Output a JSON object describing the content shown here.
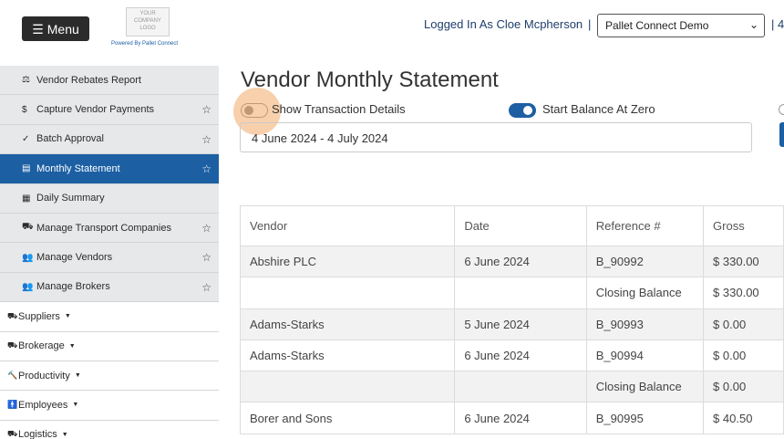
{
  "header": {
    "menu_label": "Menu",
    "logo_lines": [
      "YOUR",
      "COMPANY",
      "LOGO"
    ],
    "powered_by": "Powered By Pallet Connect",
    "logged_in": "Logged In As Cloe Mcpherson",
    "separator": "|",
    "company_select": "Pallet Connect Demo",
    "trailing": "| 4"
  },
  "sidebar": {
    "sub_items": [
      {
        "icon": "⚖",
        "label": "Vendor Rebates Report",
        "star": false,
        "active": false
      },
      {
        "icon": "$",
        "label": "Capture Vendor Payments",
        "star": true,
        "active": false
      },
      {
        "icon": "✓",
        "label": "Batch Approval",
        "star": true,
        "active": false
      },
      {
        "icon": "▤",
        "label": "Monthly Statement",
        "star": true,
        "active": true
      },
      {
        "icon": "▦",
        "label": "Daily Summary",
        "star": false,
        "active": false
      },
      {
        "icon": "⛟",
        "label": "Manage Transport Companies",
        "star": true,
        "active": false
      },
      {
        "icon": "👥",
        "label": "Manage Vendors",
        "star": true,
        "active": false
      },
      {
        "icon": "👥",
        "label": "Manage Brokers",
        "star": true,
        "active": false
      }
    ],
    "top_items": [
      {
        "icon": "⛟",
        "label": "Suppliers"
      },
      {
        "icon": "⛟",
        "label": "Brokerage"
      },
      {
        "icon": "🔨",
        "label": "Productivity"
      },
      {
        "icon": "🚹",
        "label": "Employees"
      },
      {
        "icon": "⛟",
        "label": "Logistics"
      }
    ],
    "star_glyph": "☆",
    "caret_glyph": "▼"
  },
  "main": {
    "title": "Vendor Monthly Statement",
    "show_details_label": "Show Transaction Details",
    "show_details_on": false,
    "start_zero_label": "Start Balance At Zero",
    "start_zero_on": true,
    "date_range": "4 June 2024 - 4 July 2024"
  },
  "table": {
    "columns": [
      "Vendor",
      "Date",
      "Reference #",
      "Gross"
    ],
    "rows": [
      [
        "Abshire PLC",
        "6 June 2024",
        "B_90992",
        "$ 330.00"
      ],
      [
        "",
        "",
        "Closing Balance",
        "$ 330.00"
      ],
      [
        "Adams-Starks",
        "5 June 2024",
        "B_90993",
        "$ 0.00"
      ],
      [
        "Adams-Starks",
        "6 June 2024",
        "B_90994",
        "$ 0.00"
      ],
      [
        "",
        "",
        "Closing Balance",
        "$ 0.00"
      ],
      [
        "Borer and Sons",
        "6 June 2024",
        "B_90995",
        "$ 40.50"
      ]
    ]
  },
  "colors": {
    "accent": "#1c5fa3",
    "highlight": "#f0a050"
  }
}
